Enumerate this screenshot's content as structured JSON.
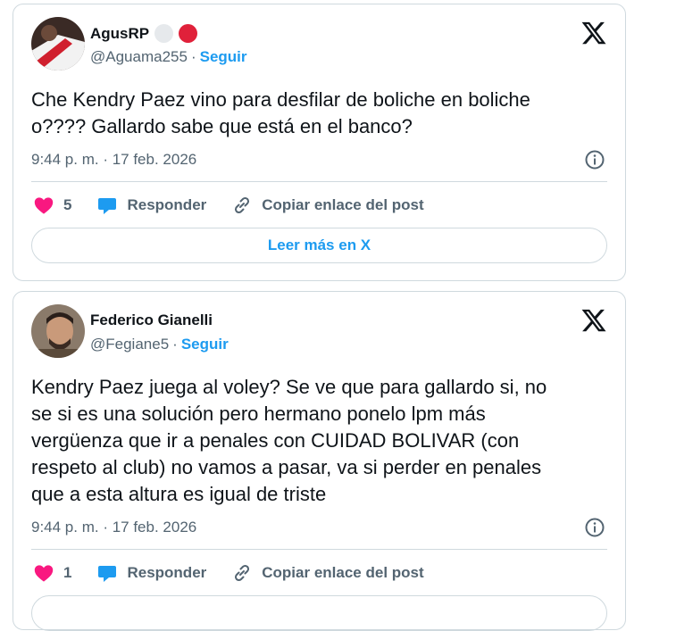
{
  "tweets": [
    {
      "name": "AgusRP",
      "handle": "@Aguama255",
      "follow_label": "Seguir",
      "separator": "·",
      "text": "Che Kendry Paez vino para desfilar de boliche en boliche\no???? Gallardo sabe que está en el banco?",
      "timestamp": "9:44 p. m. · 17 feb. 2026",
      "likes": "5",
      "reply_label": "Responder",
      "copy_link_label": "Copiar enlace del post",
      "read_more_label": "Leer más en X"
    },
    {
      "name": "Federico Gianelli",
      "handle": "@Fegiane5",
      "follow_label": "Seguir",
      "separator": "·",
      "text": "Kendry Paez juega al voley? Se ve que para gallardo si, no\nse si es una solución pero hermano ponelo lpm más\nvergüenza que ir a penales con CUIDAD BOLIVAR (con\nrespeto al club) no vamos a pasar, va si perder en penales\nque a esta altura es igual de triste",
      "timestamp": "9:44 p. m. · 17 feb. 2026",
      "likes": "1",
      "reply_label": "Responder",
      "copy_link_label": "Copiar enlace del post"
    }
  ],
  "colors": {
    "accent": "#1d9bf0",
    "heart": "#f91880",
    "secondary_text": "#536471",
    "border": "#cfd9de"
  },
  "icons": [
    "x-logo-icon",
    "info-icon",
    "heart-icon",
    "reply-bubble-icon",
    "link-icon"
  ]
}
